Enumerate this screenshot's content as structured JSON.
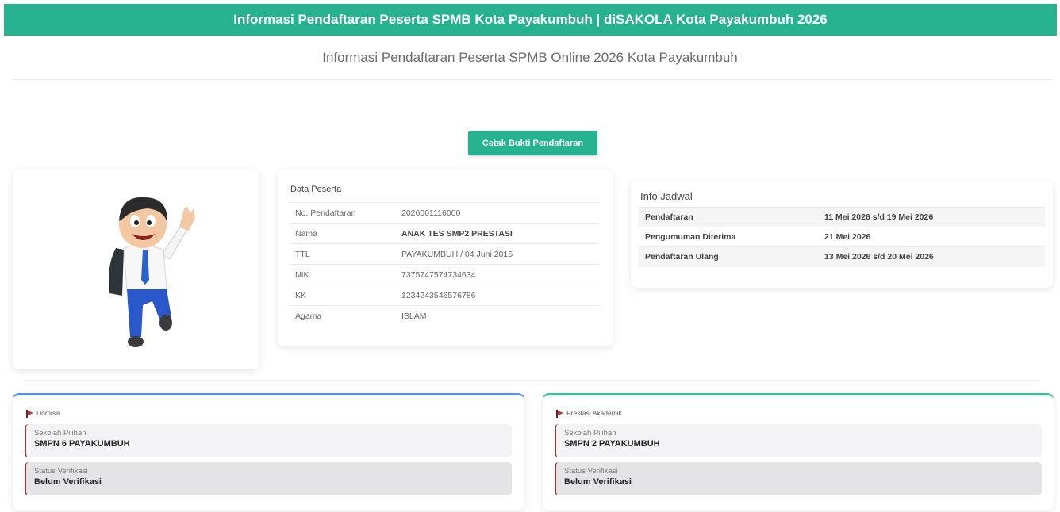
{
  "header": {
    "title": "Informasi Pendaftaran Peserta SPMB Kota Payakumbuh | diSAKOLA Kota Payakumbuh 2026"
  },
  "page": {
    "subtitle": "Informasi Pendaftaran Peserta SPMB Online 2026 Kota Payakumbuh"
  },
  "actions": {
    "print_label": "Cetak Bukti Pendaftaran"
  },
  "colors": {
    "accent": "#26b28f",
    "left_border": "#5b8def",
    "right_border": "#3bbf8f"
  },
  "peserta": {
    "title": "Data Peserta",
    "rows": [
      {
        "label": "No. Pendaftaran",
        "value": "2026001116000"
      },
      {
        "label": "Nama",
        "value": "ANAK TES SMP2 PRESTASI"
      },
      {
        "label": "TTL",
        "value": "PAYAKUMBUH / 04 Juni 2015"
      },
      {
        "label": "NIK",
        "value": "7375747574734634"
      },
      {
        "label": "KK",
        "value": "1234243546576786"
      },
      {
        "label": "Agama",
        "value": "ISLAM"
      }
    ]
  },
  "jadwal": {
    "title": "Info Jadwal",
    "rows": [
      {
        "label": "Pendaftaran",
        "value": "11 Mei 2026 s/d 19 Mei 2026"
      },
      {
        "label": "Pengumuman Diterima",
        "value": "21 Mei 2026"
      },
      {
        "label": "Pendaftaran Ulang",
        "value": "13 Mei 2026 s/d 20 Mei 2026"
      }
    ]
  },
  "choices": [
    {
      "jalur": "Domisili",
      "school_label": "Sekolah Pilihan",
      "school": "SMPN 6 PAYAKUMBUH",
      "status_label": "Status Verifikasi",
      "status": "Belum Verifikasi"
    },
    {
      "jalur": "Prestasi Akademik",
      "school_label": "Sekolah Pilihan",
      "school": "SMPN 2 PAYAKUMBUH",
      "status_label": "Status Verifikasi",
      "status": "Belum Verifikasi"
    }
  ]
}
